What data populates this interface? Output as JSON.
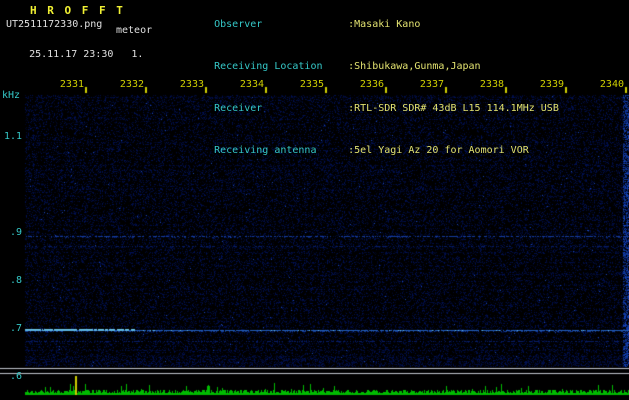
{
  "header": {
    "app_title": "H R O F F T",
    "filename": "UT2511172330.png",
    "mode_label": "meteor",
    "datetime": "25.11.17 23:30",
    "sequence": "1.",
    "info": [
      {
        "label": "Observer",
        "value": ":Masaki Kano"
      },
      {
        "label": "Receiving Location",
        "value": ":Shibukawa,Gunma,Japan"
      },
      {
        "label": "Receiver",
        "value": ":RTL-SDR SDR# 43dB L15 114.1MHz USB"
      },
      {
        "label": "Receiving antenna",
        "value": ":5el Yagi Az 20 for Aomori VOR"
      }
    ]
  },
  "colors": {
    "background": "#000000",
    "title_yellow": "#f0f033",
    "tick_yellow": "#d0d000",
    "axis_cyan": "#35c8c8",
    "value_yellow": "#e2e270",
    "text_white": "#e0e0e0",
    "separator_white": "#c0c4cc",
    "level_green": "#00bb00",
    "marker_yellow": "#cccc00"
  },
  "chart_data": {
    "type": "heatmap",
    "subtype": "radio-meteor-spectrogram",
    "title": "HROFFT 10-minute spectrogram 2025-11-17 23:30-23:40 UT",
    "x_axis": {
      "unit": "time UT (hhmm)",
      "start": "2330",
      "end": "2340",
      "minutes_per_division": 1,
      "tick_labels": [
        "2331",
        "2332",
        "2333",
        "2334",
        "2335",
        "2336",
        "2337",
        "2338",
        "2339",
        "2340"
      ]
    },
    "y_axis": {
      "label": "kHz",
      "tick_labels": [
        "1.1",
        ".9",
        ".8",
        ".7",
        ".6"
      ],
      "tick_values_khz": [
        1.1,
        0.9,
        0.8,
        0.7,
        0.6
      ],
      "visible_range_khz": [
        0.58,
        1.19
      ]
    },
    "signal_lines": [
      {
        "freq_khz": 0.893,
        "strength": "medium",
        "description": "faint dotted carrier line just below 0.9 kHz"
      },
      {
        "freq_khz": 0.872,
        "strength": "weak",
        "description": "very faint dotted line"
      },
      {
        "freq_khz": 0.697,
        "strength": "strong",
        "description": "continuous carrier line, brightest (cyan) at left edge"
      },
      {
        "freq_khz": 0.676,
        "strength": "weak",
        "description": "very faint dotted line"
      }
    ],
    "background_content": "dark blue random noise floor, slightly brighter band along bottom edge and brighter speckle column at right edge",
    "meteor_echoes": "none prominent in this interval",
    "bottom_graph": {
      "type": "area",
      "description": "green received-signal-level trace vs time; low grass-like noise with small spikes",
      "marker": {
        "color": "yellow",
        "approx_time_s_from_start": 50
      }
    }
  }
}
